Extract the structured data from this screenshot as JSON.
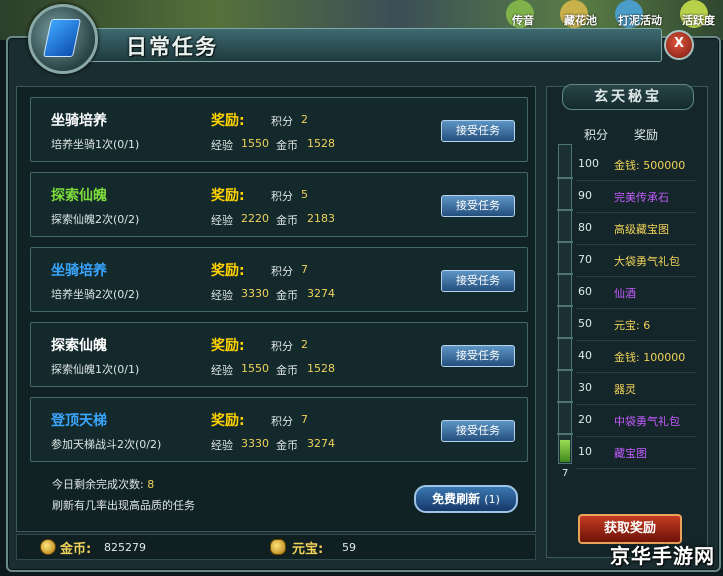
{
  "top_labels": [
    "传音",
    "藏花池",
    "打泥活动",
    "活跃度"
  ],
  "window": {
    "title": "日常任务",
    "close_label": "X"
  },
  "tasks": [
    {
      "name": "坐骑培养",
      "name_color": "#ffffff",
      "desc": "培养坐骑1次(0/1)",
      "reward_label": "奖励:",
      "points_label": "积分",
      "points": "2",
      "exp_label": "经验",
      "exp": "1550",
      "gold_label": "金币",
      "gold": "1528",
      "accept_label": "接受任务"
    },
    {
      "name": "探索仙魄",
      "name_color": "#7ddc3b",
      "desc": "探索仙魄2次(0/2)",
      "reward_label": "奖励:",
      "points_label": "积分",
      "points": "5",
      "exp_label": "经验",
      "exp": "2220",
      "gold_label": "金币",
      "gold": "2183",
      "accept_label": "接受任务"
    },
    {
      "name": "坐骑培养",
      "name_color": "#3aa6ff",
      "desc": "培养坐骑2次(0/2)",
      "reward_label": "奖励:",
      "points_label": "积分",
      "points": "7",
      "exp_label": "经验",
      "exp": "3330",
      "gold_label": "金币",
      "gold": "3274",
      "accept_label": "接受任务"
    },
    {
      "name": "探索仙魄",
      "name_color": "#ffffff",
      "desc": "探索仙魄1次(0/1)",
      "reward_label": "奖励:",
      "points_label": "积分",
      "points": "2",
      "exp_label": "经验",
      "exp": "1550",
      "gold_label": "金币",
      "gold": "1528",
      "accept_label": "接受任务"
    },
    {
      "name": "登顶天梯",
      "name_color": "#3aa6ff",
      "desc": "参加天梯战斗2次(0/2)",
      "reward_label": "奖励:",
      "points_label": "积分",
      "points": "7",
      "exp_label": "经验",
      "exp": "3330",
      "gold_label": "金币",
      "gold": "3274",
      "accept_label": "接受任务"
    }
  ],
  "footer": {
    "remaining_label": "今日剩余完成次数:",
    "remaining_value": "8",
    "hint": "刷新有几率出现高品质的任务",
    "refresh_label": "免费刷新",
    "refresh_count": "(1)"
  },
  "currency": {
    "gold_label": "金币:",
    "gold_value": "825279",
    "yuanbao_label": "元宝:",
    "yuanbao_value": "59"
  },
  "side_panel": {
    "title": "玄天秘宝",
    "points_header": "积分",
    "reward_header": "奖励",
    "current_points": "7",
    "progress_fraction": 0.07,
    "rewards": [
      {
        "points": "100",
        "reward": "金钱: 500000",
        "color": "#f0d25a"
      },
      {
        "points": "90",
        "reward": "完美传承石",
        "color": "#c45bff"
      },
      {
        "points": "80",
        "reward": "高级藏宝图",
        "color": "#f0d25a"
      },
      {
        "points": "70",
        "reward": "大袋勇气礼包",
        "color": "#f0d25a"
      },
      {
        "points": "60",
        "reward": "仙酒",
        "color": "#c45bff"
      },
      {
        "points": "50",
        "reward": "元宝: 6",
        "color": "#f0d25a"
      },
      {
        "points": "40",
        "reward": "金钱: 100000",
        "color": "#f0d25a"
      },
      {
        "points": "30",
        "reward": "器灵",
        "color": "#f0d25a"
      },
      {
        "points": "20",
        "reward": "中袋勇气礼包",
        "color": "#c45bff"
      },
      {
        "points": "10",
        "reward": "藏宝图",
        "color": "#c45bff"
      }
    ],
    "claim_label": "获取奖励"
  },
  "watermark": "京华手游网"
}
